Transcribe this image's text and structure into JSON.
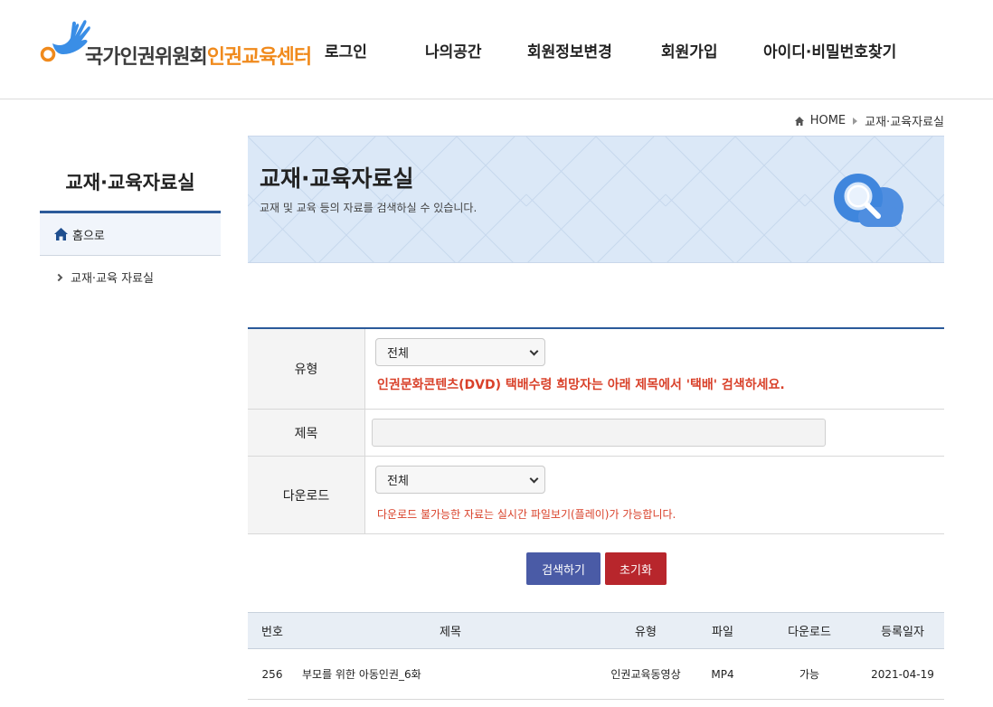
{
  "header": {
    "logo_text_main": "국가인권위원회",
    "logo_text_sub": "인권교육센터",
    "nav": [
      "로그인",
      "나의공간",
      "회원정보변경",
      "회원가입",
      "아이디·비밀번호찾기"
    ]
  },
  "breadcrumb": {
    "home": "HOME",
    "current": "교재·교육자료실"
  },
  "sidebar": {
    "title": "교재·교육자료실",
    "home_label": "홈으로",
    "items": [
      "교재·교육 자료실"
    ]
  },
  "banner": {
    "title": "교재·교육자료실",
    "description": "교재 및 교육 등의 자료를 검색하실 수 있습니다."
  },
  "search": {
    "type_label": "유형",
    "type_value": "전체",
    "type_notice": "인권문화콘텐츠(DVD) 택배수령 희망자는 아래 제목에서 '택배' 검색하세요.",
    "title_label": "제목",
    "title_value": "",
    "download_label": "다운로드",
    "download_value": "전체",
    "download_notice": "다운로드 불가능한 자료는 실시간 파일보기(플레이)가 가능합니다.",
    "search_button": "검색하기",
    "reset_button": "초기화"
  },
  "table": {
    "headers": [
      "번호",
      "제목",
      "유형",
      "파일",
      "다운로드",
      "등록일자"
    ],
    "rows": [
      {
        "no": "256",
        "title": "부모를 위한 아동인권_6화",
        "type": "인권교육동영상",
        "file": "MP4",
        "download": "가능",
        "date": "2021-04-19"
      }
    ]
  },
  "colors": {
    "accent": "#2b5a9a",
    "brand_orange": "#f08a1c",
    "notice_red": "#d9412a",
    "search_button": "#4a5ba6",
    "reset_button": "#b8262c"
  }
}
